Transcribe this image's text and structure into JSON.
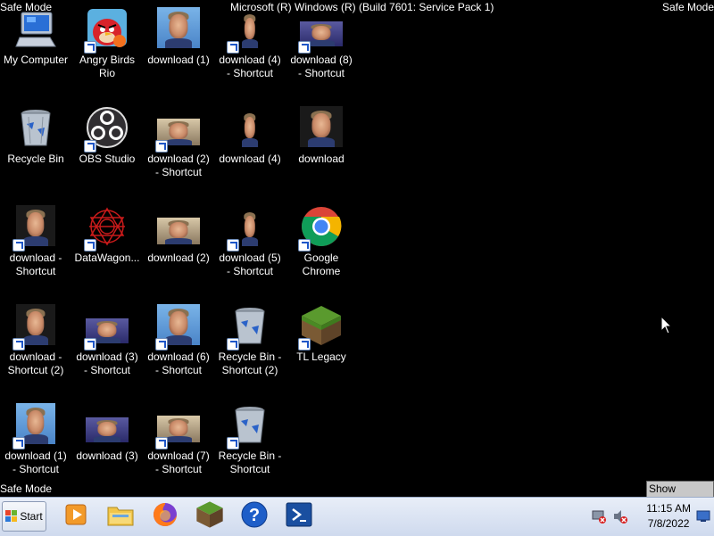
{
  "watermarks": {
    "top_left": "Safe Mode",
    "top_right": "Safe Mode",
    "bottom_left": "Safe Mode",
    "center": "Microsoft (R) Windows (R) (Build 7601: Service Pack 1)"
  },
  "desktop": {
    "icons": [
      {
        "label": "My Computer",
        "kind": "computer-icon"
      },
      {
        "label": "Recycle Bin",
        "kind": "recycle-bin-icon"
      },
      {
        "label": "download -\nShortcut",
        "kind": "photo-icon"
      },
      {
        "label": "download -\nShortcut (2)",
        "kind": "photo-icon"
      },
      {
        "label": "download (1)\n- Shortcut",
        "kind": "photo-icon"
      },
      {
        "label": "Angry Birds\nRio",
        "kind": "angry-birds-icon"
      },
      {
        "label": "OBS Studio",
        "kind": "obs-icon"
      },
      {
        "label": "DataWagon...",
        "kind": "datawagon-icon"
      },
      {
        "label": "download (3)\n- Shortcut",
        "kind": "photo-icon"
      },
      {
        "label": "download (3)",
        "kind": "photo-icon"
      },
      {
        "label": "download (1)",
        "kind": "photo-icon"
      },
      {
        "label": "download (2)\n- Shortcut",
        "kind": "photo-icon"
      },
      {
        "label": "download (2)",
        "kind": "photo-icon"
      },
      {
        "label": "download (6)\n- Shortcut",
        "kind": "photo-icon"
      },
      {
        "label": "download (7)\n- Shortcut",
        "kind": "photo-icon"
      },
      {
        "label": "download (4)\n- Shortcut",
        "kind": "photo-icon"
      },
      {
        "label": "download (4)",
        "kind": "photo-icon"
      },
      {
        "label": "download (5)\n- Shortcut",
        "kind": "photo-icon"
      },
      {
        "label": "Recycle Bin -\nShortcut (2)",
        "kind": "recycle-bin-icon"
      },
      {
        "label": "Recycle Bin -\nShortcut",
        "kind": "recycle-bin-icon"
      },
      {
        "label": "download (8)\n- Shortcut",
        "kind": "photo-icon"
      },
      {
        "label": "download",
        "kind": "photo-icon"
      },
      {
        "label": "Google\nChrome",
        "kind": "chrome-icon"
      },
      {
        "label": "TL Legacy",
        "kind": "minecraft-icon"
      }
    ]
  },
  "taskbar": {
    "start_label": "Start",
    "pinned": [
      {
        "name": "media-player-icon"
      },
      {
        "name": "file-explorer-icon"
      },
      {
        "name": "firefox-icon"
      },
      {
        "name": "minecraft-icon"
      },
      {
        "name": "help-icon"
      },
      {
        "name": "powershell-icon"
      }
    ],
    "clock_time": "11:15 AM",
    "clock_date": "7/8/2022",
    "show_desktop_tooltip": "Show desktop"
  }
}
